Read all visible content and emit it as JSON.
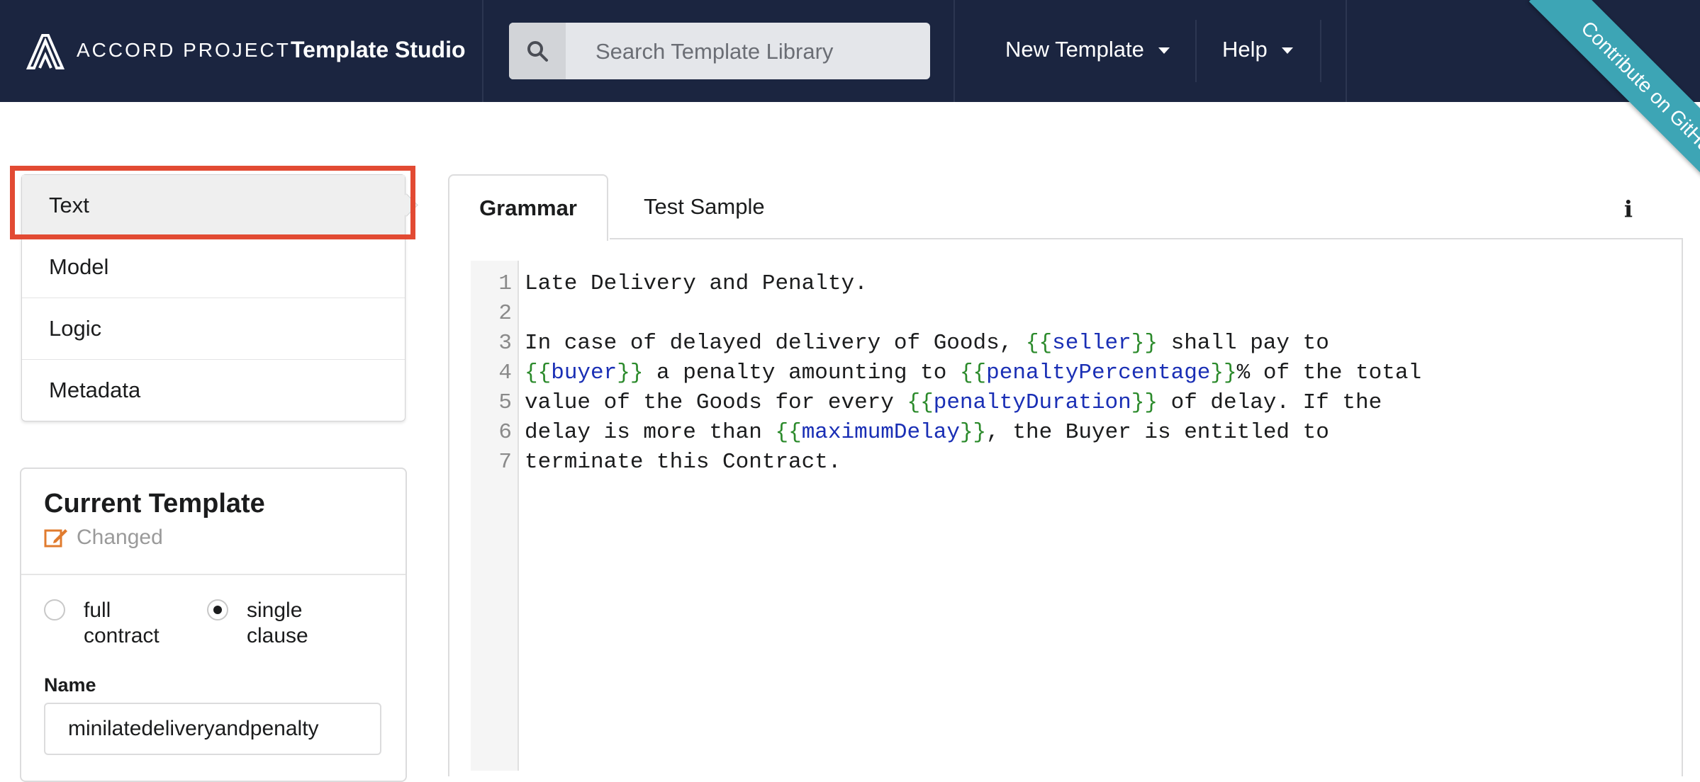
{
  "header": {
    "brand": "ACCORD PROJECT",
    "app_title": "Template Studio",
    "search_placeholder": "Search Template Library",
    "menu_new_template": "New Template",
    "menu_help": "Help",
    "ribbon": "Contribute on GitHub",
    "colors": {
      "bar": "#1b2540",
      "ribbon": "#3da5b5"
    }
  },
  "sidebar": {
    "items": [
      {
        "label": "Text",
        "active": true
      },
      {
        "label": "Model",
        "active": false
      },
      {
        "label": "Logic",
        "active": false
      },
      {
        "label": "Metadata",
        "active": false
      }
    ]
  },
  "current_template": {
    "title": "Current Template",
    "status": "Changed",
    "status_icon": "edit-icon",
    "options": [
      {
        "label": "full contract",
        "checked": false
      },
      {
        "label": "single clause",
        "checked": true
      }
    ],
    "name_label": "Name",
    "name_value": "minilatedeliveryandpenalty"
  },
  "editor": {
    "tabs": [
      {
        "label": "Grammar",
        "active": true
      },
      {
        "label": "Test Sample",
        "active": false
      }
    ],
    "info_icon": "info-icon",
    "line_numbers": [
      "1",
      "2",
      "3",
      "4",
      "5",
      "6",
      "7"
    ],
    "lines": [
      [
        {
          "t": "text",
          "v": "Late Delivery and Penalty."
        }
      ],
      [],
      [
        {
          "t": "text",
          "v": "In case of delayed delivery of Goods, "
        },
        {
          "t": "brace",
          "v": "{{"
        },
        {
          "t": "var",
          "v": "seller"
        },
        {
          "t": "brace",
          "v": "}}"
        },
        {
          "t": "text",
          "v": " shall pay to"
        }
      ],
      [
        {
          "t": "brace",
          "v": "{{"
        },
        {
          "t": "var",
          "v": "buyer"
        },
        {
          "t": "brace",
          "v": "}}"
        },
        {
          "t": "text",
          "v": " a penalty amounting to "
        },
        {
          "t": "brace",
          "v": "{{"
        },
        {
          "t": "var",
          "v": "penaltyPercentage"
        },
        {
          "t": "brace",
          "v": "}}"
        },
        {
          "t": "text",
          "v": "% of the total"
        }
      ],
      [
        {
          "t": "text",
          "v": "value of the Goods for every "
        },
        {
          "t": "brace",
          "v": "{{"
        },
        {
          "t": "var",
          "v": "penaltyDuration"
        },
        {
          "t": "brace",
          "v": "}}"
        },
        {
          "t": "text",
          "v": " of delay. If the"
        }
      ],
      [
        {
          "t": "text",
          "v": "delay is more than "
        },
        {
          "t": "brace",
          "v": "{{"
        },
        {
          "t": "var",
          "v": "maximumDelay"
        },
        {
          "t": "brace",
          "v": "}}"
        },
        {
          "t": "text",
          "v": ", the Buyer is entitled to"
        }
      ],
      [
        {
          "t": "text",
          "v": "terminate this Contract."
        }
      ]
    ]
  }
}
